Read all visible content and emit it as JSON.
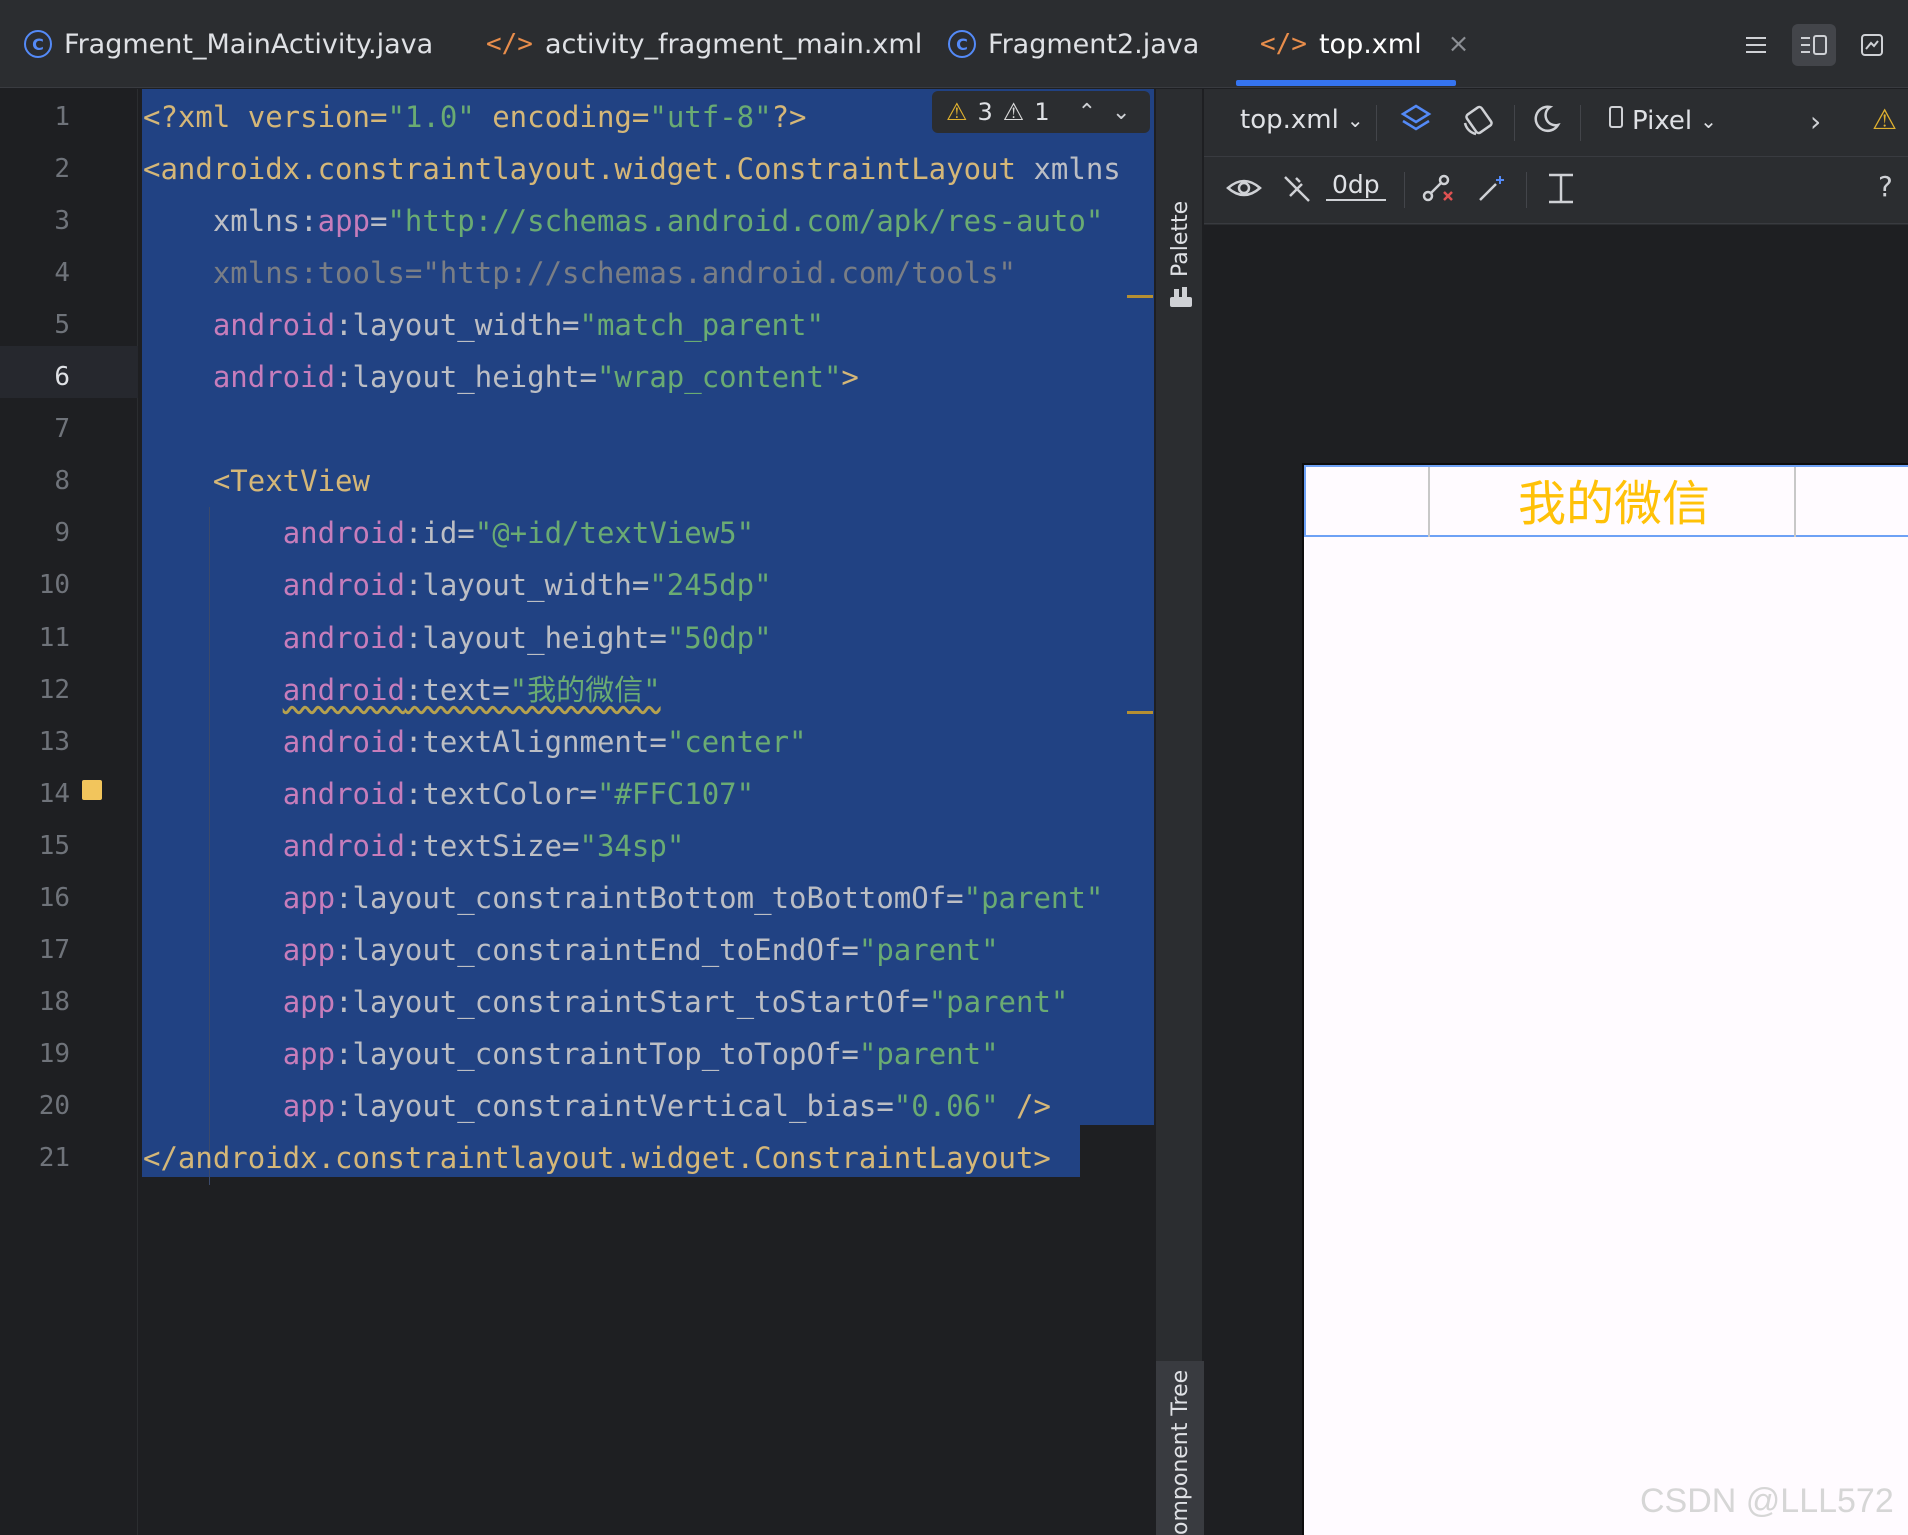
{
  "tabs": [
    {
      "label": "Fragment_MainActivity.java",
      "icon": "java-class-icon"
    },
    {
      "label": "activity_fragment_main.xml",
      "icon": "xml-icon"
    },
    {
      "label": "Fragment2.java",
      "icon": "java-class-icon"
    },
    {
      "label": "top.xml",
      "icon": "xml-icon",
      "active": true
    }
  ],
  "icon_glyphs": {
    "java": "C",
    "xml": "</>",
    "close": "×"
  },
  "editor": {
    "line_numbers": [
      "1",
      "2",
      "3",
      "4",
      "5",
      "6",
      "7",
      "8",
      "9",
      "10",
      "11",
      "12",
      "13",
      "14",
      "15",
      "16",
      "17",
      "18",
      "19",
      "20",
      "21"
    ],
    "current_line": "6",
    "inspection": {
      "warnings": "3",
      "weak_warnings": "1"
    },
    "lines": [
      [
        "<?xml version=",
        "\"1.0\"",
        " encoding=",
        "\"utf-8\"",
        "?>"
      ],
      [
        "<androidx.constraintlayout.widget.ConstraintLayout",
        " xmlns"
      ],
      [
        "    xmlns:",
        "app",
        "=",
        "\"http://schemas.android.com/apk/res-auto\""
      ],
      [
        "    xmlns:tools=\"http://schemas.android.com/tools\""
      ],
      [
        "    ",
        "android",
        ":layout_width=",
        "\"match_parent\""
      ],
      [
        "    ",
        "android",
        ":layout_height=",
        "\"wrap_content\"",
        ">"
      ],
      [
        ""
      ],
      [
        "    ",
        "<TextView"
      ],
      [
        "        ",
        "android",
        ":id=",
        "\"@+id/textView5\""
      ],
      [
        "        ",
        "android",
        ":layout_width=",
        "\"245dp\""
      ],
      [
        "        ",
        "android",
        ":layout_height=",
        "\"50dp\""
      ],
      [
        "        ",
        "android",
        ":text=",
        "\"我的微信\""
      ],
      [
        "        ",
        "android",
        ":textAlignment=",
        "\"center\""
      ],
      [
        "        ",
        "android",
        ":textColor=",
        "\"#FFC107\""
      ],
      [
        "        ",
        "android",
        ":textSize=",
        "\"34sp\""
      ],
      [
        "        ",
        "app",
        ":layout_constraintBottom_toBottomOf=",
        "\"parent\""
      ],
      [
        "        ",
        "app",
        ":layout_constraintEnd_toEndOf=",
        "\"parent\""
      ],
      [
        "        ",
        "app",
        ":layout_constraintStart_toStartOf=",
        "\"parent\""
      ],
      [
        "        ",
        "app",
        ":layout_constraintTop_toTopOf=",
        "\"parent\""
      ],
      [
        "        ",
        "app",
        ":layout_constraintVertical_bias=",
        "\"0.06\"",
        " />"
      ],
      [
        "</androidx.constraintlayout.widget.ConstraintLayout>"
      ]
    ]
  },
  "side_panels": {
    "palette": "Palette",
    "component_tree": "omponent Tree"
  },
  "design": {
    "file_selector": "top.xml",
    "device_selector": "Pixel",
    "margin_value": "0dp",
    "help": "?",
    "preview_text": "我的微信",
    "preview_text_color": "#FFC107"
  },
  "watermark": "CSDN @LLL572",
  "colors": {
    "background": "#1e1f22",
    "panel": "#2b2d30",
    "selection": "#214283",
    "accent": "#3574f0",
    "warning": "#e0b12f"
  }
}
